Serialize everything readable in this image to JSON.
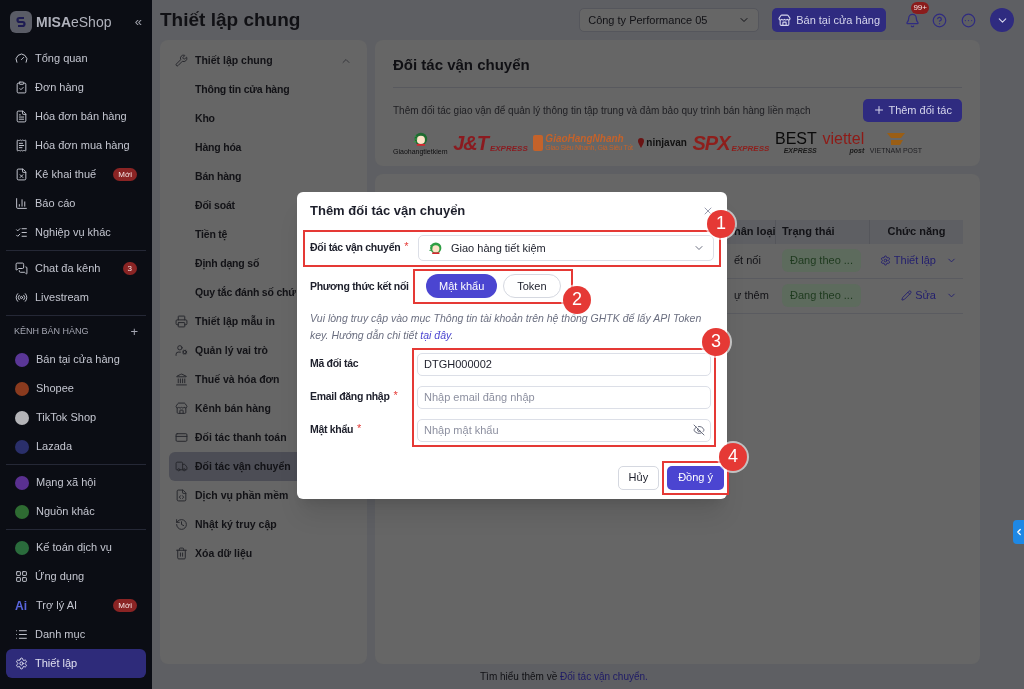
{
  "sidebar": {
    "logo": {
      "brand": "MISA",
      "product": "eShop"
    },
    "collapse": "«",
    "sections": [
      {
        "items": [
          {
            "label": "Tổng quan",
            "selected": false
          },
          {
            "label": "Đơn hàng",
            "selected": false
          },
          {
            "label": "Hóa đơn bán hàng",
            "selected": false
          },
          {
            "label": "Hóa đơn mua hàng",
            "selected": false
          },
          {
            "label": "Kê khai thuế",
            "badge": "Mới",
            "selected": false
          },
          {
            "label": "Báo cáo",
            "selected": false
          },
          {
            "label": "Nghiệp vụ khác",
            "selected": false
          }
        ]
      },
      {
        "items": [
          {
            "label": "Chat đa kênh",
            "badge": "3",
            "selected": false
          },
          {
            "label": "Livestream",
            "selected": false
          }
        ]
      },
      {
        "title": "KÊNH BÁN HÀNG",
        "add": "+",
        "items": [
          {
            "label": "Bán tại cửa hàng",
            "color": "#5a3696",
            "selected": false
          },
          {
            "label": "Shopee",
            "color": "#8a3a1e",
            "selected": false
          },
          {
            "label": "TikTok Shop",
            "color": "#b4b4b8",
            "selected": false
          },
          {
            "label": "Lazada",
            "color": "#2a2f6a",
            "selected": false
          }
        ]
      },
      {
        "items": [
          {
            "label": "Mạng xã hội",
            "color": "#5a3090",
            "selected": false
          },
          {
            "label": "Nguồn khác",
            "color": "#2e6b32",
            "selected": false
          }
        ]
      },
      {
        "items": [
          {
            "label": "Kế toán dịch vụ",
            "color": "#2a6b3c",
            "selected": false
          },
          {
            "label": "Ứng dụng",
            "selected": false
          },
          {
            "label": "Trợ lý AI",
            "prefix": "Ai",
            "badge": "Mới",
            "selected": false
          },
          {
            "label": "Danh mục",
            "selected": false
          },
          {
            "label": "Thiết lập",
            "selected": true
          }
        ]
      }
    ]
  },
  "header": {
    "title": "Thiết lập chung",
    "company": "Công ty Performance 05",
    "store_button": "Bán tại cửa hàng",
    "notification_count": "99+"
  },
  "settings_nav": {
    "items": [
      {
        "label": "Thiết lập chung",
        "expanded": true,
        "selected": false,
        "children": [
          {
            "label": "Thông tin cửa hàng",
            "selected": false
          },
          {
            "label": "Kho",
            "selected": false
          },
          {
            "label": "Hàng hóa",
            "selected": false
          },
          {
            "label": "Bán hàng",
            "selected": false
          },
          {
            "label": "Đối soát",
            "selected": false
          },
          {
            "label": "Tiền tệ",
            "selected": false
          },
          {
            "label": "Định dạng số",
            "selected": false
          },
          {
            "label": "Quy tắc đánh số chứ",
            "selected": false
          }
        ]
      },
      {
        "label": "Thiết lập mẫu in",
        "selected": false
      },
      {
        "label": "Quản lý vai trò",
        "selected": false
      },
      {
        "label": "Thuế và hóa đơn",
        "selected": false
      },
      {
        "label": "Kênh bán hàng",
        "selected": false
      },
      {
        "label": "Đối tác thanh toán",
        "selected": false
      },
      {
        "label": "Đối tác vận chuyển",
        "selected": true
      },
      {
        "label": "Dịch vụ phần mềm",
        "selected": false
      },
      {
        "label": "Nhật ký truy cập",
        "selected": false
      },
      {
        "label": "Xóa dữ liệu",
        "selected": false
      }
    ]
  },
  "partners_card": {
    "title": "Đối tác vận chuyển",
    "description": "Thêm đối tác giao vận để quản lý thông tin tập trung và đảm bảo quy trình bán hàng liền mạch",
    "add_button": "Thêm đối tác",
    "logos": [
      {
        "kind": "mascot",
        "text": "Giaohangtietkiem",
        "color": "#1f6a30"
      },
      {
        "kind": "wordmark",
        "text": "J&T",
        "sub": "EXPRESS",
        "color": "#8b1a1f"
      },
      {
        "kind": "badge",
        "text": "GiaoHangNhanh",
        "sub": "Giao Siêu Nhanh, Giá Siêu Tốt",
        "color": "#c4622a"
      },
      {
        "kind": "pin",
        "text": "ninjavan",
        "color": "#111111"
      },
      {
        "kind": "wordmark",
        "text": "SPX",
        "sub": "EXPRESS",
        "color": "#8e1e1b"
      },
      {
        "kind": "stacked",
        "text": "BEST",
        "sub": "EXPRESS",
        "color": "#0a0a0a"
      },
      {
        "kind": "stacked",
        "text": "viettel",
        "sub": "post",
        "color": "#8e1a16"
      },
      {
        "kind": "emblem",
        "text": "VIETNAM POST",
        "color": "#9a5e15"
      }
    ]
  },
  "table": {
    "columns": [
      "hân loại",
      "Trạng thái",
      "Chức năng"
    ],
    "rows": [
      {
        "type": "ết nối",
        "status": "Đang theo ...",
        "action": "Thiết lập"
      },
      {
        "type": "ự thêm",
        "status": "Đang theo ...",
        "action": "Sửa"
      }
    ]
  },
  "footer": {
    "text": "Tìm hiểu thêm về",
    "link": "Đối tác vận chuyển."
  },
  "dialog": {
    "title": "Thêm đối tác vận chuyển",
    "partner": {
      "label": "Đối tác vận chuyển",
      "required_mark": "*",
      "value": "Giao hàng tiết kiệm",
      "callout": "1"
    },
    "method": {
      "label": "Phương thức kết nối",
      "callout": "2",
      "options": [
        {
          "label": "Mật khẩu",
          "selected": true
        },
        {
          "label": "Token",
          "selected": false
        }
      ]
    },
    "help": {
      "text": "Vui lòng truy cập vào mục Thông tin tài khoản trên hệ thống GHTK để lấy API Token key. Hướng dẫn chi tiết ",
      "link": "tại đây",
      "end": "."
    },
    "fields": {
      "callout": "3",
      "items": [
        {
          "label": "Mã đối tác",
          "kind": "text",
          "value": "DTGH000002"
        },
        {
          "label": "Email đăng nhập",
          "required_mark": "*",
          "kind": "text",
          "placeholder": "Nhập email đăng nhập"
        },
        {
          "label": "Mật khẩu",
          "required_mark": "*",
          "kind": "password",
          "placeholder": "Nhập mật khẩu"
        }
      ]
    },
    "buttons": {
      "cancel": "Hủy",
      "confirm": "Đồng ý",
      "callout": "4"
    }
  }
}
